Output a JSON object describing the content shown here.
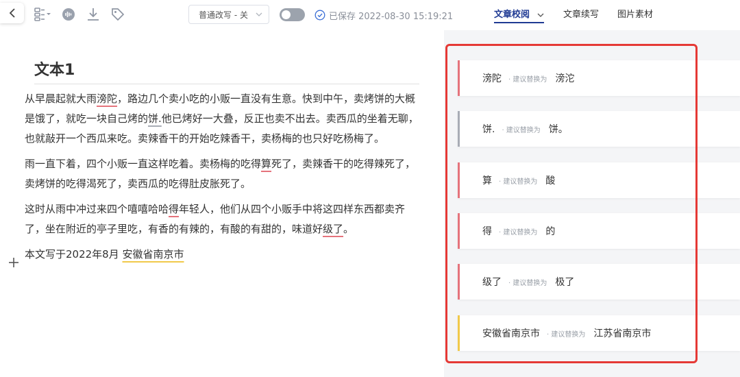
{
  "toolbar": {
    "mode_label": "普通改写 - 关",
    "saved_text": "已保存 2022-08-30 15:19:21",
    "icons": [
      "back-arrow-icon",
      "layout-menu-icon",
      "audio-icon",
      "download-icon",
      "tag-icon",
      "check-circle-icon"
    ]
  },
  "tabs": [
    {
      "label": "文章校阅",
      "active": true
    },
    {
      "label": "文章续写",
      "active": false
    },
    {
      "label": "图片素材",
      "active": false
    }
  ],
  "doc": {
    "title": "文本1",
    "p1": {
      "a": "从早晨起就大雨",
      "e1": "滂陀",
      "b": "，路边几个卖小吃的小贩一直没有生意。快到中午，卖烤饼的大概是饿了，就吃一块自己烤的",
      "e2": "饼.",
      "c": "他已烤好一大叠，反正也卖不出去。卖西瓜的坐着无聊，也就敲开一个西瓜来吃。卖辣香干的开始吃辣香干，卖杨梅的也只好吃杨梅了。"
    },
    "p2": {
      "a": "雨一直下着，四个小贩一直这样吃着。卖杨梅的吃得",
      "e1": "算",
      "b": "死了，卖辣香干的吃得辣死了，卖烤饼的吃得渴死了，卖西瓜的吃得肚皮胀死了。"
    },
    "p3": {
      "a": "这时从雨中冲过来四个嘻嘻哈哈",
      "e1": "得",
      "b": "年轻人，他们从四个小贩手中将这四样东西都卖齐了，坐在附近的亭子里吃，有香的有辣的，有酸的有甜的，味道好",
      "e2": "级了",
      "c": "。"
    },
    "p4": {
      "a": "本文写于2022年8月 ",
      "e1": "安徽省南京市"
    }
  },
  "corrections": [
    {
      "original": "滂陀",
      "hint": "· 建议替换为",
      "suggestion": "滂沱",
      "color": "#e5737c"
    },
    {
      "original": "饼.",
      "hint": "· 建议替换为",
      "suggestion": "饼。",
      "color": "#a8acb5"
    },
    {
      "original": "算",
      "hint": "· 建议替换为",
      "suggestion": "酸",
      "color": "#e5737c"
    },
    {
      "original": "得",
      "hint": "· 建议替换为",
      "suggestion": "的",
      "color": "#e5737c"
    },
    {
      "original": "级了",
      "hint": "· 建议替换为",
      "suggestion": "极了",
      "color": "#e5737c"
    },
    {
      "original": "安徽省南京市",
      "hint": "· 建议替换为",
      "suggestion": "江苏省南京市",
      "color": "#f0c94a"
    }
  ],
  "colors": {
    "accent": "#1f3a93",
    "highlight_frame": "#e53935"
  }
}
